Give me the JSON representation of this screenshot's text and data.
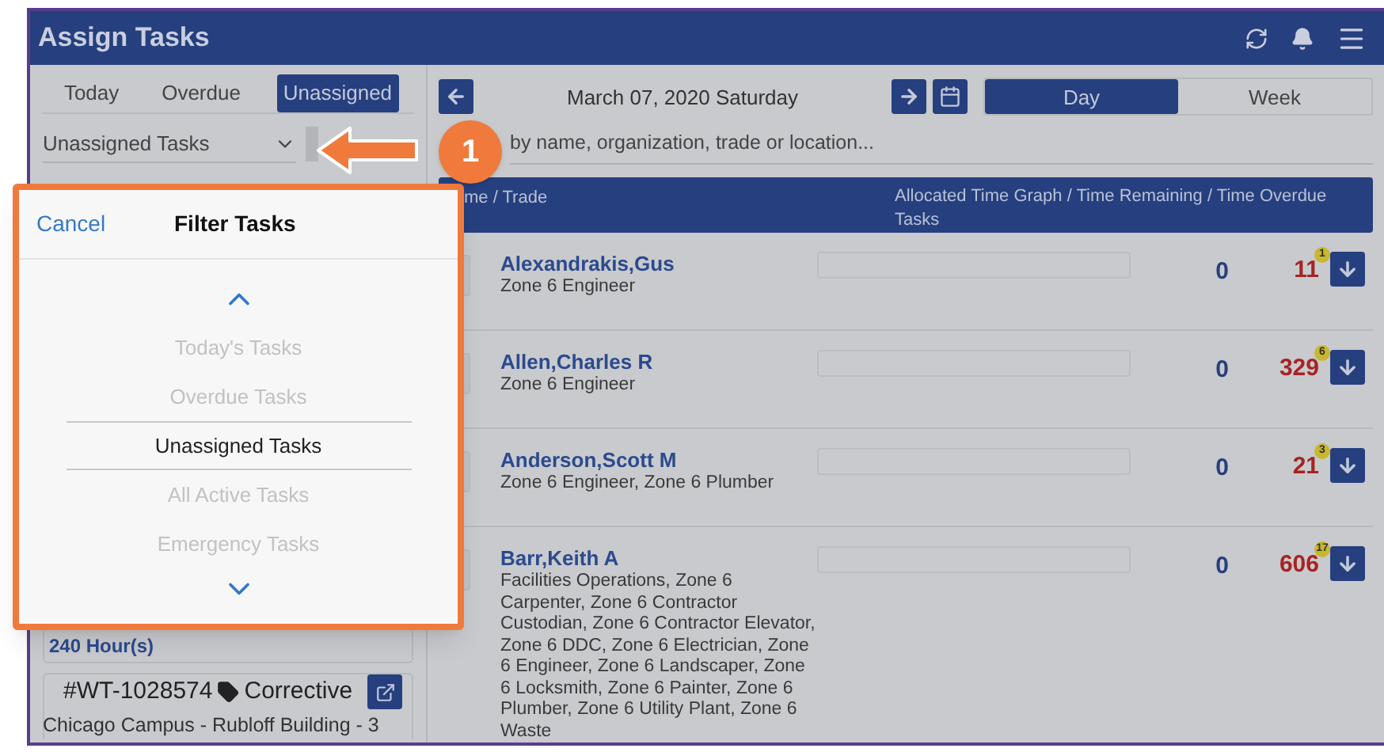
{
  "window": {
    "title": "Assign Tasks"
  },
  "tabs": [
    {
      "label": "Today",
      "selected": false
    },
    {
      "label": "Overdue",
      "selected": false
    },
    {
      "label": "Unassigned",
      "selected": true
    }
  ],
  "filter_dropdown": {
    "value": "Unassigned Tasks"
  },
  "date_nav": {
    "date": "March 07, 2020 Saturday"
  },
  "view_toggle": [
    {
      "label": "Day",
      "selected": true
    },
    {
      "label": "Week",
      "selected": false
    }
  ],
  "search": {
    "placeholder": "by name, organization, trade or location..."
  },
  "table": {
    "columns": [
      "me / Trade",
      "Allocated Time Graph / Time Remaining / Time Overdue Tasks"
    ],
    "rows": [
      {
        "name": "Alexandrakis,Gus",
        "trades": "Zone 6 Engineer",
        "remaining": "0",
        "overdue": "11",
        "overdue_count": "1"
      },
      {
        "name": "Allen,Charles R",
        "trades": "Zone 6 Engineer",
        "remaining": "0",
        "overdue": "329",
        "overdue_count": "6"
      },
      {
        "name": "Anderson,Scott M",
        "trades": "Zone 6 Engineer, Zone 6 Plumber",
        "remaining": "0",
        "overdue": "21",
        "overdue_count": "3"
      },
      {
        "name": "Barr,Keith A",
        "trades": "Facilities Operations, Zone 6 Carpenter, Zone 6 Contractor Custodian, Zone 6 Contractor Elevator, Zone 6 DDC, Zone 6 Electrician, Zone 6 Engineer, Zone 6 Landscaper, Zone 6 Locksmith, Zone 6 Painter, Zone 6 Plumber, Zone 6 Utility Plant, Zone 6 Waste",
        "remaining": "0",
        "overdue": "606",
        "overdue_count": "17"
      }
    ]
  },
  "task_cards": [
    {
      "hours": "240 Hour(s)"
    },
    {
      "number": "#WT-1028574",
      "type": "Corrective",
      "location": "Chicago Campus - Rubloff Building - 3"
    }
  ],
  "popup": {
    "cancel": "Cancel",
    "title": "Filter Tasks",
    "options": [
      {
        "label": "Today's Tasks",
        "selected": false
      },
      {
        "label": "Overdue Tasks",
        "selected": false
      },
      {
        "label": "Unassigned Tasks",
        "selected": true
      },
      {
        "label": "All Active Tasks",
        "selected": false
      },
      {
        "label": "Emergency Tasks",
        "selected": false
      }
    ]
  },
  "callout": {
    "number": "1"
  }
}
